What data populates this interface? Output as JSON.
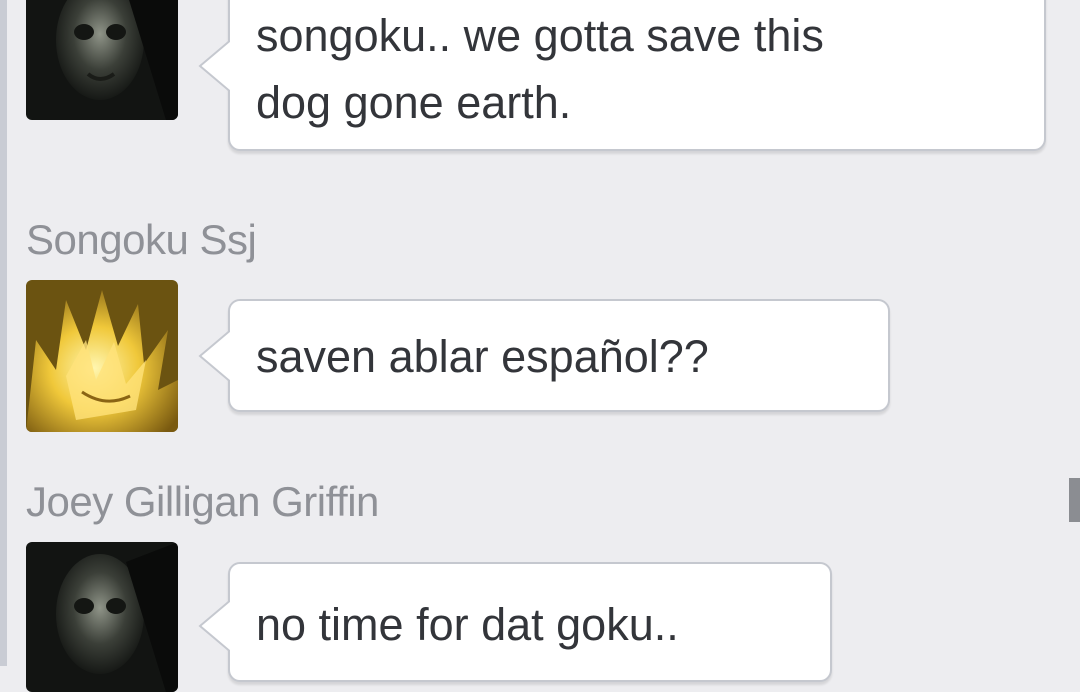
{
  "conversation": {
    "messages": [
      {
        "sender": "",
        "avatar_icon": "dark-skull-avatar-icon",
        "lines": [
          "songoku.. we gotta save this",
          "dog gone earth."
        ]
      },
      {
        "sender": "Songoku Ssj",
        "avatar_icon": "super-saiyan-avatar-icon",
        "lines": [
          "saven ablar español??"
        ]
      },
      {
        "sender": "Joey Gilligan Griffin",
        "avatar_icon": "dark-skull-avatar-icon",
        "lines": [
          "no time for dat goku.."
        ]
      }
    ]
  },
  "colors": {
    "background": "#ededf0",
    "bubble": "#ffffff",
    "bubble_border": "#c5c8cf",
    "sender_name": "#8f9197",
    "message_text": "#33353a"
  }
}
